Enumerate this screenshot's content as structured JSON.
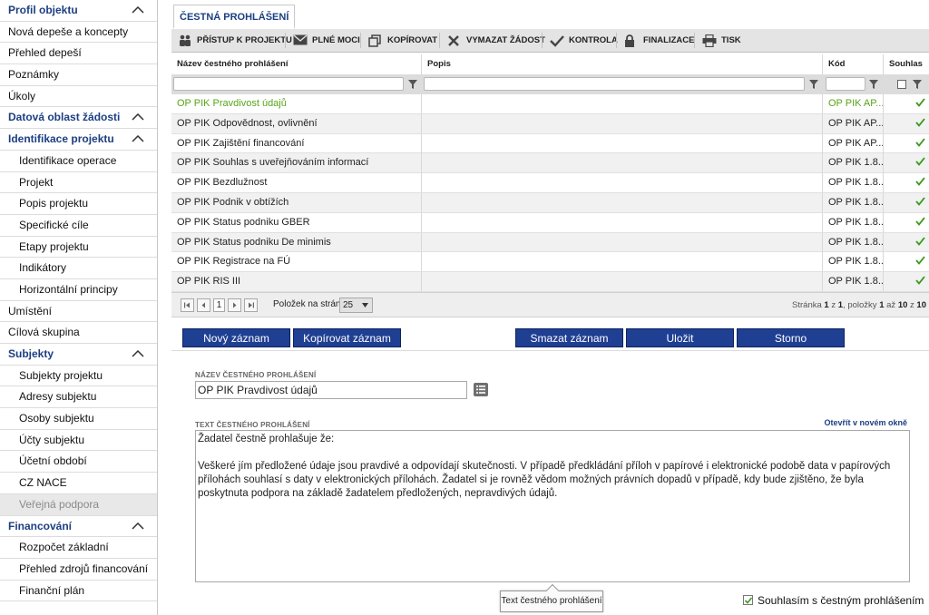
{
  "sidebar": {
    "items": [
      {
        "label": "Profil objektu",
        "type": "header"
      },
      {
        "label": "Nová depeše a koncepty",
        "type": "item"
      },
      {
        "label": "Přehled depeší",
        "type": "item"
      },
      {
        "label": "Poznámky",
        "type": "item"
      },
      {
        "label": "Úkoly",
        "type": "item"
      },
      {
        "label": "Datová oblast žádosti",
        "type": "header"
      },
      {
        "label": "Identifikace projektu",
        "type": "section"
      },
      {
        "label": "Identifikace operace",
        "type": "sub"
      },
      {
        "label": "Projekt",
        "type": "sub"
      },
      {
        "label": "Popis projektu",
        "type": "sub"
      },
      {
        "label": "Specifické cíle",
        "type": "sub"
      },
      {
        "label": "Etapy projektu",
        "type": "sub"
      },
      {
        "label": "Indikátory",
        "type": "sub"
      },
      {
        "label": "Horizontální principy",
        "type": "sub"
      },
      {
        "label": "Umístění",
        "type": "item"
      },
      {
        "label": "Cílová skupina",
        "type": "item"
      },
      {
        "label": "Subjekty",
        "type": "section"
      },
      {
        "label": "Subjekty projektu",
        "type": "sub"
      },
      {
        "label": "Adresy subjektu",
        "type": "sub"
      },
      {
        "label": "Osoby subjektu",
        "type": "sub"
      },
      {
        "label": "Účty subjektu",
        "type": "sub"
      },
      {
        "label": "Účetní období",
        "type": "sub"
      },
      {
        "label": "CZ NACE",
        "type": "sub"
      },
      {
        "label": "Veřejná podpora",
        "type": "sub-disabled"
      },
      {
        "label": "Financování",
        "type": "section"
      },
      {
        "label": "Rozpočet základní",
        "type": "sub"
      },
      {
        "label": "Přehled zdrojů financování",
        "type": "sub"
      },
      {
        "label": "Finanční plán",
        "type": "sub"
      }
    ]
  },
  "tab": {
    "label": "ČESTNÁ PROHLÁŠENÍ"
  },
  "toolbar": {
    "access": "PŘÍSTUP K PROJEKTU",
    "power": "PLNÉ MOCI",
    "copy": "KOPÍROVAT",
    "delete": "VYMAZAT ŽÁDOST",
    "check": "KONTROLA",
    "finalize": "FINALIZACE",
    "print": "TISK"
  },
  "grid": {
    "columns": {
      "name": "Název čestného prohlášení",
      "desc": "Popis",
      "code": "Kód",
      "consent": "Souhlas"
    },
    "rows": [
      {
        "name": "OP PIK Pravdivost údajů",
        "desc": "",
        "code": "OP PIK AP...",
        "consent": true
      },
      {
        "name": "OP PIK Odpovědnost, ovlivnění",
        "desc": "",
        "code": "OP PIK AP...",
        "consent": true
      },
      {
        "name": "OP PIK Zajištění financování",
        "desc": "",
        "code": "OP PIK AP...",
        "consent": true
      },
      {
        "name": "OP PIK Souhlas s uveřejňováním informací",
        "desc": "",
        "code": "OP PIK 1.8...",
        "consent": true
      },
      {
        "name": "OP PIK Bezdlužnost",
        "desc": "",
        "code": "OP PIK 1.8...",
        "consent": true
      },
      {
        "name": "OP PIK Podnik v obtížích",
        "desc": "",
        "code": "OP PIK 1.8...",
        "consent": true
      },
      {
        "name": "OP PIK Status podniku GBER",
        "desc": "",
        "code": "OP PIK 1.8...",
        "consent": true
      },
      {
        "name": "OP PIK Status podniku De minimis",
        "desc": "",
        "code": "OP PIK 1.8...",
        "consent": true
      },
      {
        "name": "OP PIK Registrace na FÚ",
        "desc": "",
        "code": "OP PIK 1.8...",
        "consent": true
      },
      {
        "name": "OP PIK RIS III",
        "desc": "",
        "code": "OP PIK 1.8...",
        "consent": true
      }
    ]
  },
  "pager": {
    "page": "1",
    "per_page_label": "Položek na stránku",
    "per_page": "25",
    "info_page_label": "Stránka",
    "info_page": "1",
    "info_of": "z",
    "info_pages": "1",
    "info_items_label": ", položky",
    "info_from": "1",
    "info_to_label": "až",
    "info_to": "10",
    "info_total_of": "z",
    "info_total": "10"
  },
  "actions": {
    "new": "Nový záznam",
    "copy": "Kopírovat záznam",
    "delete": "Smazat záznam",
    "save": "Uložit",
    "cancel": "Storno"
  },
  "form": {
    "name_label": "NÁZEV ČESTNÉHO PROHLÁŠENÍ",
    "name_value": "OP PIK Pravdivost údajů",
    "text_label": "TEXT ČESTNÉHO PROHLÁŠENÍ",
    "open_link": "Otevřít v novém okně",
    "text_value": "Žadatel čestně prohlašuje že:\n\nVeškeré jím předložené údaje jsou pravdivé a odpovídají skutečnosti. V případě předkládání příloh v papírové i elektronické podobě data v papírových přílohách souhlasí s daty v elektronických přílohách. Žadatel si je rovněž vědom možných právních dopadů v případě, kdy bude zjištěno, že byla poskytnuta podpora na základě žadatelem předložených, nepravdivých údajů.",
    "tooltip": "Text čestného prohlášení",
    "agree_label": "Souhlasím s čestným prohlášením",
    "agree_checked": true
  },
  "colors": {
    "accent": "#1f3f93",
    "header_text": "#1c3f82",
    "selected_row": "#58a516",
    "check": "#3a9a1a"
  }
}
